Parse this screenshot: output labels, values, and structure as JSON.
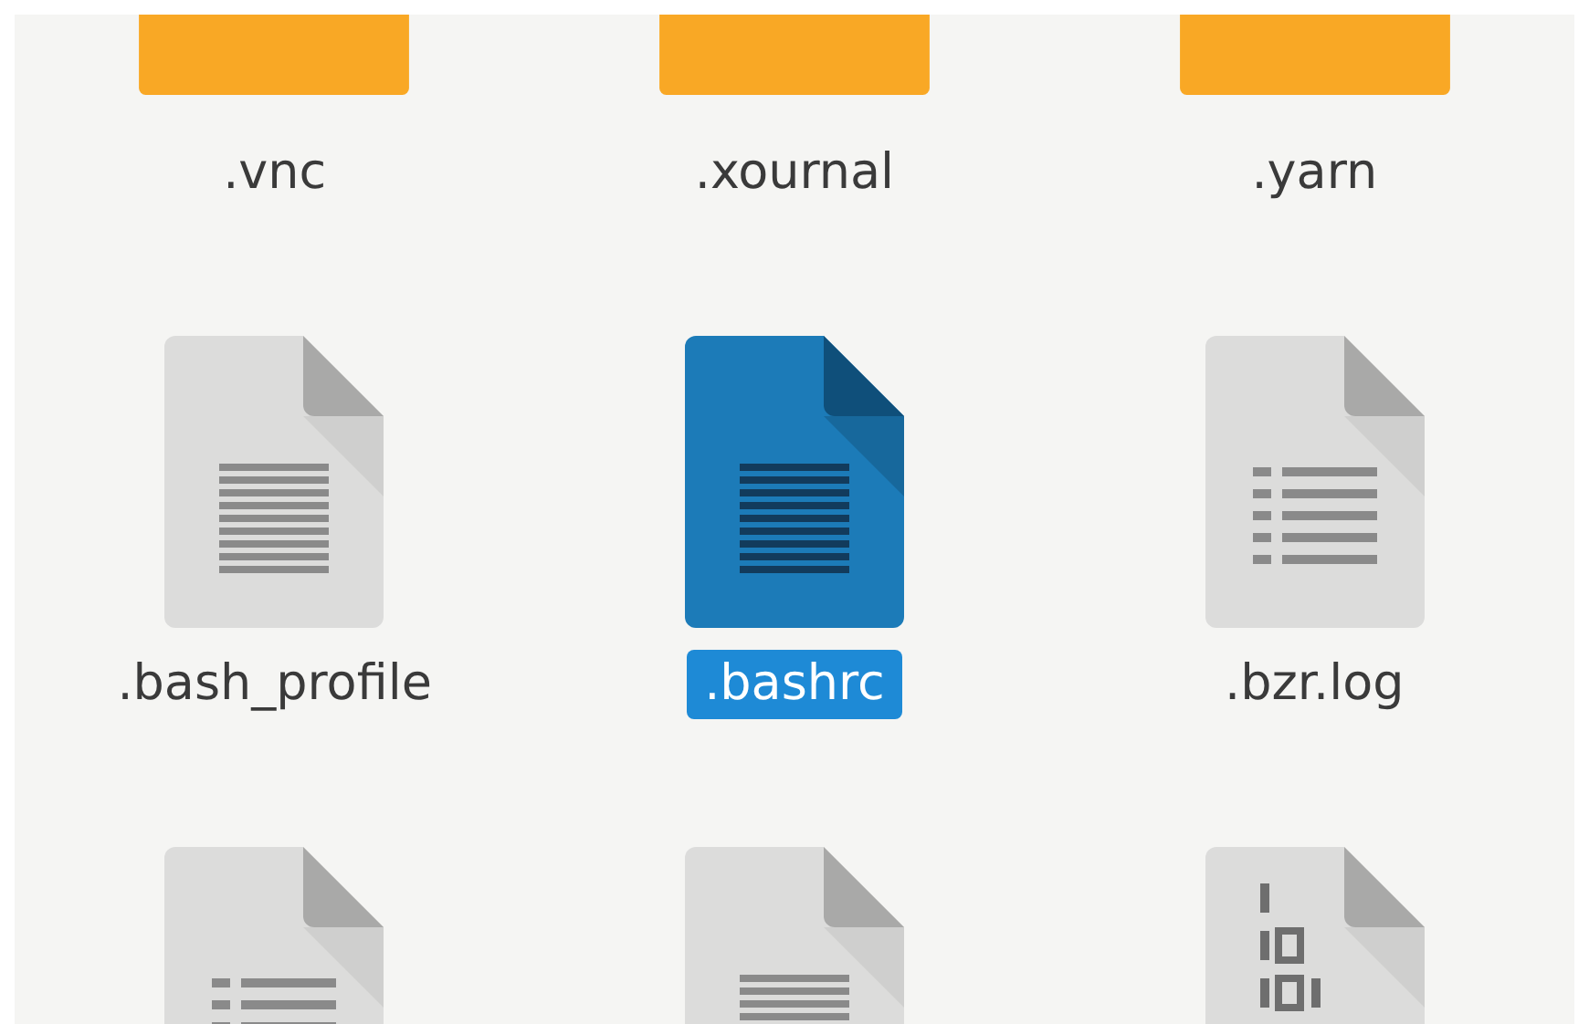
{
  "items": [
    {
      "kind": "folder",
      "label": ".vnc",
      "selected": false
    },
    {
      "kind": "folder",
      "label": ".xournal",
      "selected": false
    },
    {
      "kind": "folder",
      "label": ".yarn",
      "selected": false
    },
    {
      "kind": "text",
      "label": ".bash_profile",
      "selected": false
    },
    {
      "kind": "text",
      "label": ".bashrc",
      "selected": true
    },
    {
      "kind": "list",
      "label": ".bzr.log",
      "selected": false
    },
    {
      "kind": "list",
      "selected": false
    },
    {
      "kind": "text",
      "selected": false
    },
    {
      "kind": "binary",
      "selected": false
    }
  ]
}
